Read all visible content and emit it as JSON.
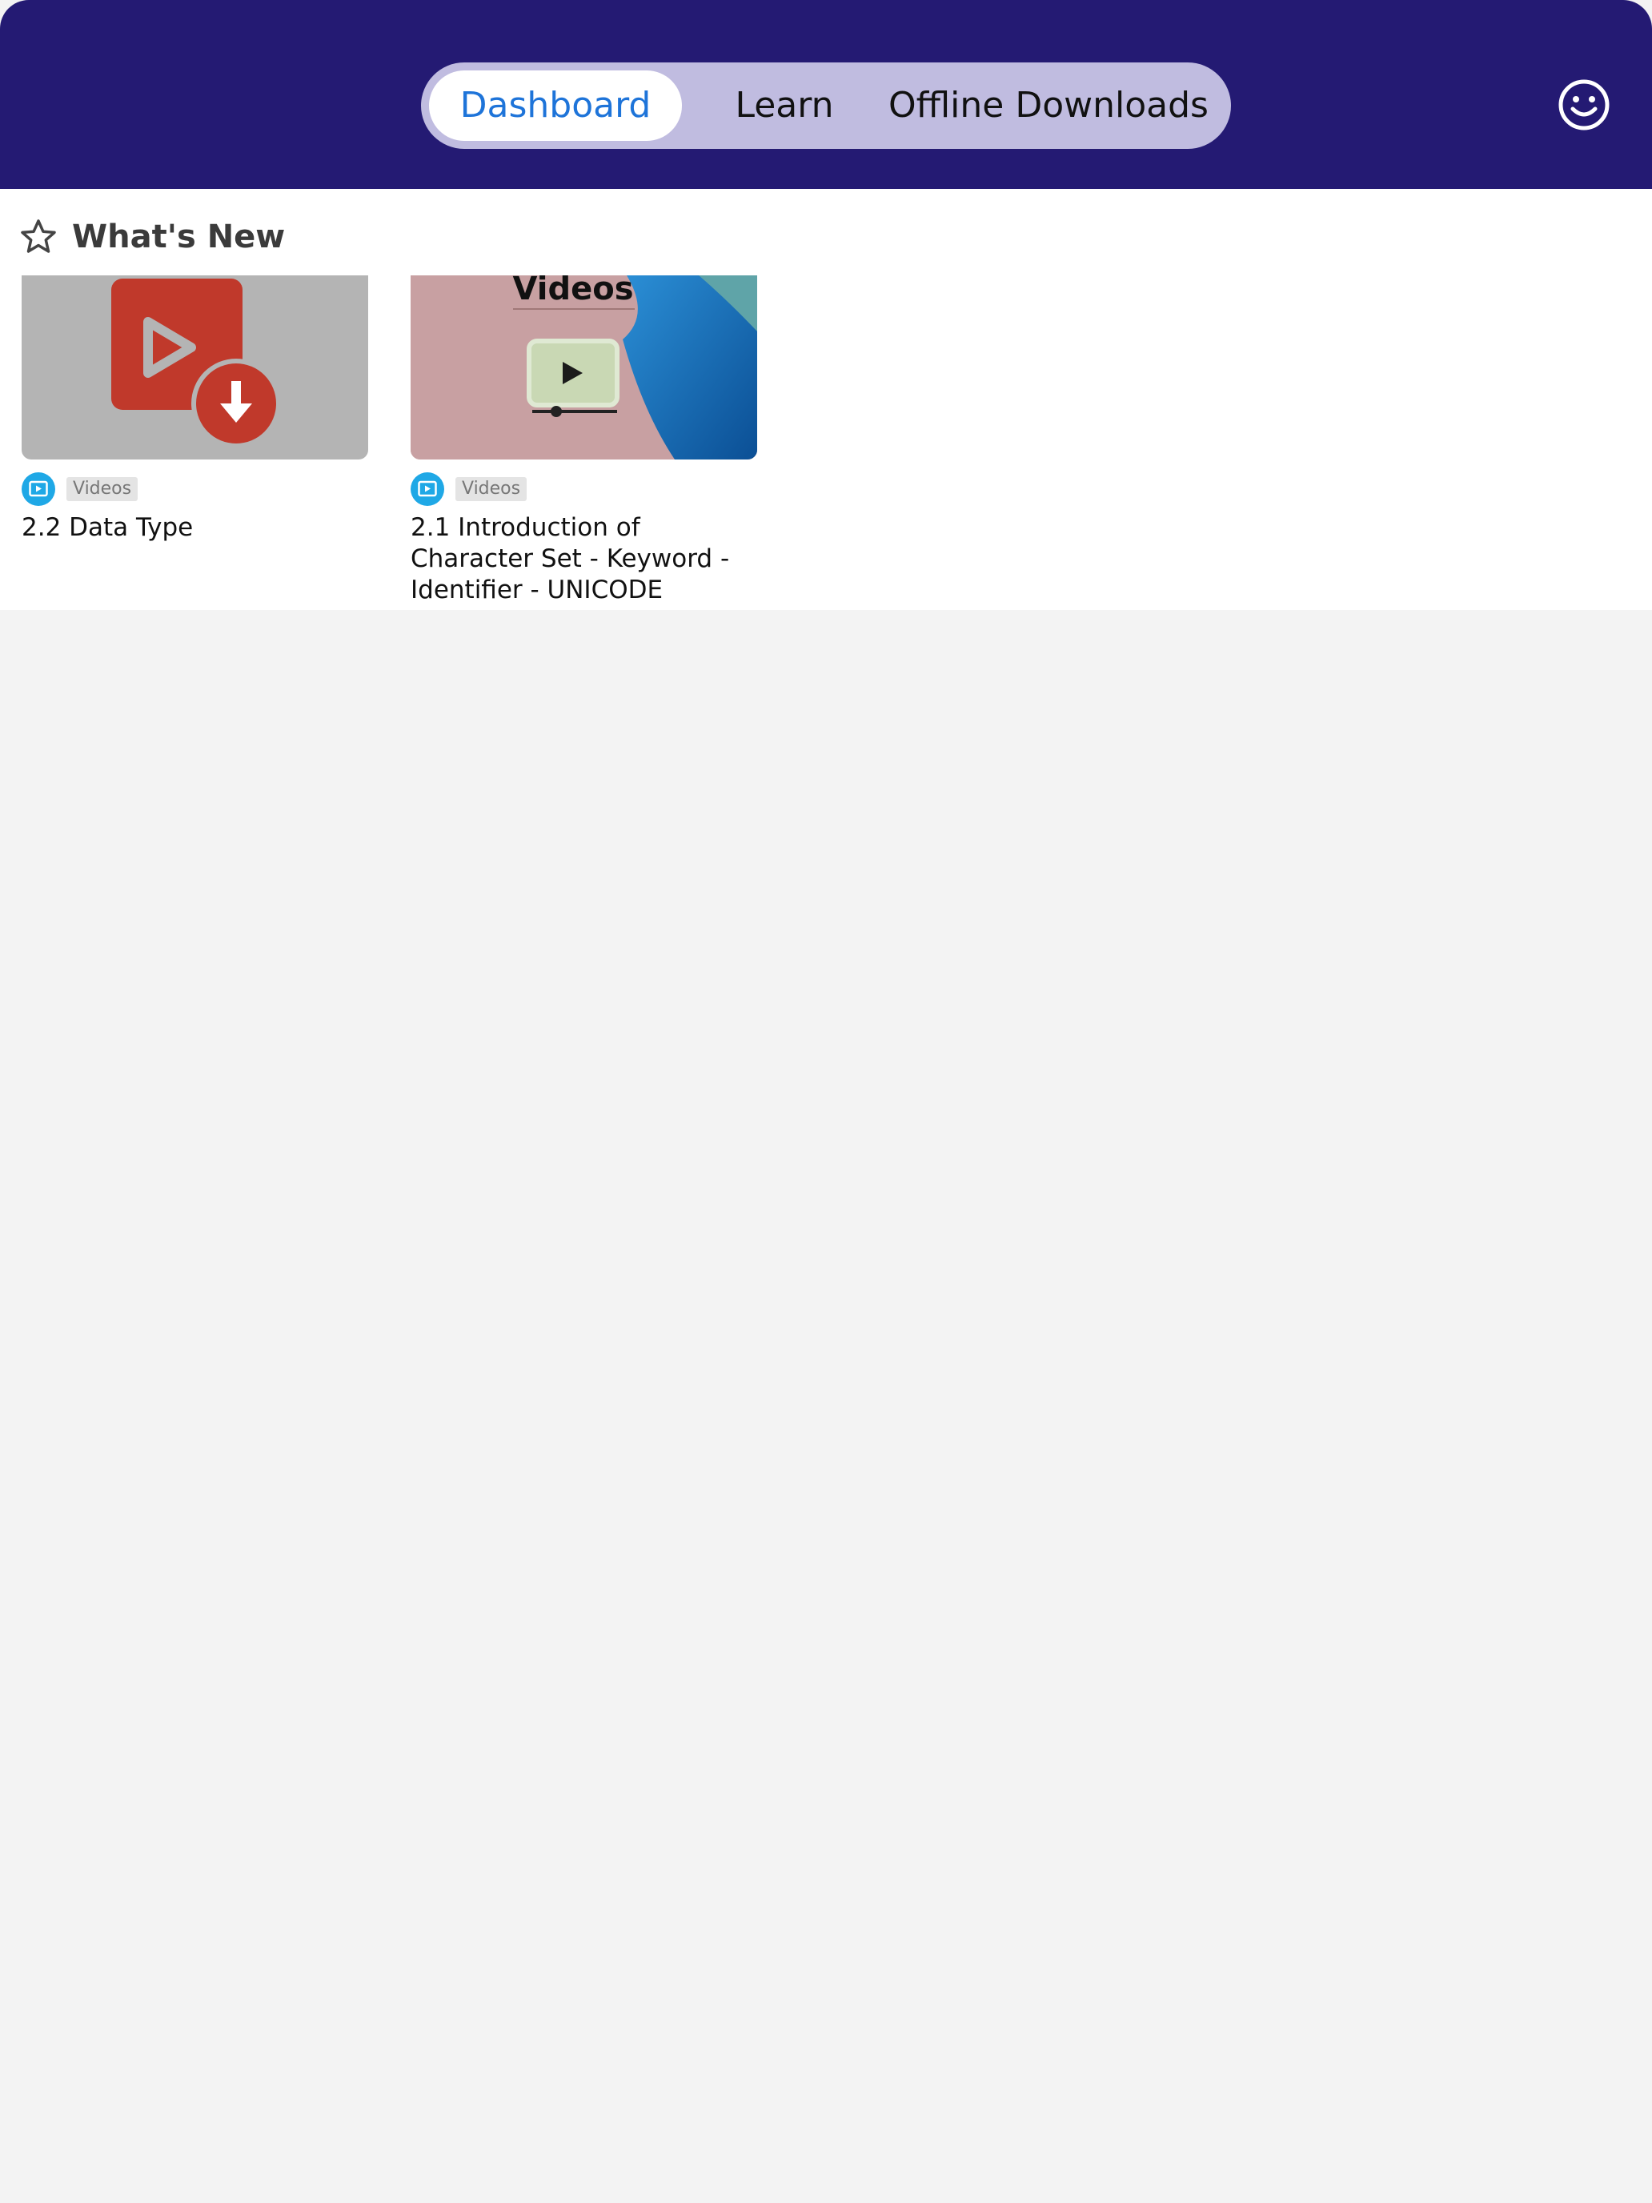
{
  "header": {
    "tabs": [
      {
        "label": "Dashboard",
        "active": true
      },
      {
        "label": "Learn",
        "active": false
      },
      {
        "label": "Offline Downloads",
        "active": false
      }
    ],
    "profile_icon": "smiley-face-icon",
    "colors": {
      "header_bg": "#241a73",
      "segment_bg": "#c0bce0",
      "active_tab_text": "#1e74d9"
    }
  },
  "whats_new": {
    "title": "What's New",
    "icon": "star-outline-icon",
    "items": [
      {
        "type_label": "Videos",
        "title": "2.2 Data Type",
        "thumbnail_icon": "video-download-icon"
      },
      {
        "type_label": "Videos",
        "title": "2.1 Introduction of Character Set - Keyword - Identifier - UNICODE",
        "thumbnail_text": "Videos",
        "thumbnail_icon": "video-player-icon"
      }
    ]
  }
}
